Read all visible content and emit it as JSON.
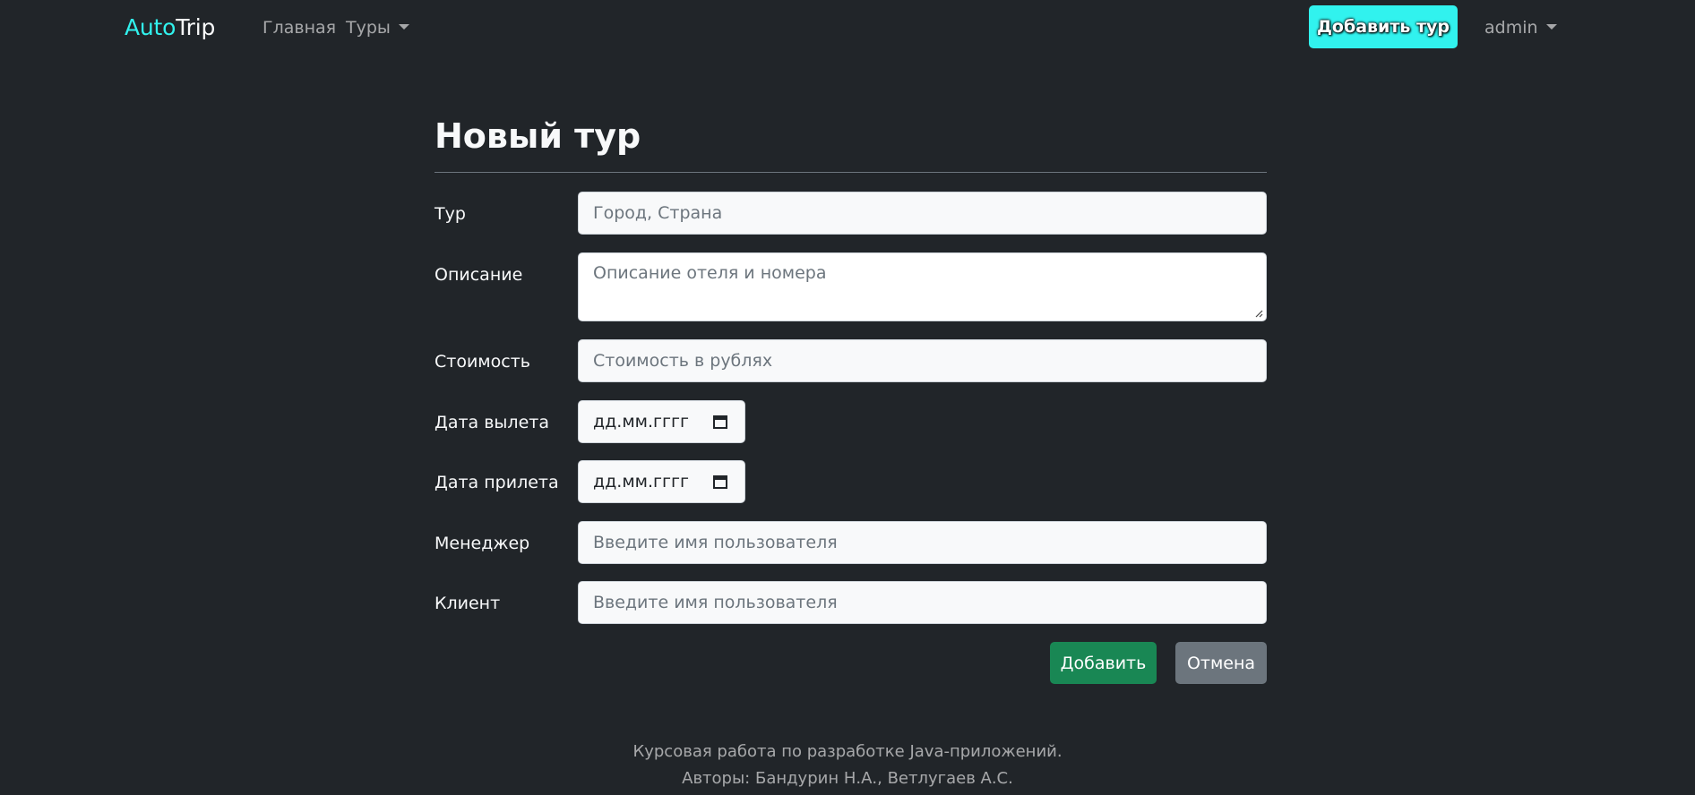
{
  "navbar": {
    "brand_part1": "Auto",
    "brand_part2": "Trip",
    "links": {
      "home": "Главная",
      "tours": "Туры"
    },
    "add_tour_button": "Добавить тур",
    "user_menu": "admin"
  },
  "page": {
    "title": "Новый тур"
  },
  "form": {
    "tour": {
      "label": "Тур",
      "placeholder": "Город, Страна"
    },
    "description": {
      "label": "Описание",
      "placeholder": "Описание отеля и номера"
    },
    "price": {
      "label": "Стоимость",
      "placeholder": "Стоимость в рублях"
    },
    "departure": {
      "label": "Дата вылета",
      "value": "дд.мм.гггг"
    },
    "arrival": {
      "label": "Дата прилета",
      "value": "дд.мм.гггг"
    },
    "manager": {
      "label": "Менеджер",
      "placeholder": "Введите имя пользователя"
    },
    "client": {
      "label": "Клиент",
      "placeholder": "Введите имя пользователя"
    },
    "submit_label": "Добавить",
    "cancel_label": "Отмена"
  },
  "footer": {
    "line1": "Курсовая работа по разработке Java-приложений.",
    "line2": "Авторы: Бандурин Н.А., Ветлугаев А.С."
  },
  "colors": {
    "background": "#212529",
    "accent": "#31f2ee",
    "success": "#198754",
    "secondary": "#6c757d"
  }
}
